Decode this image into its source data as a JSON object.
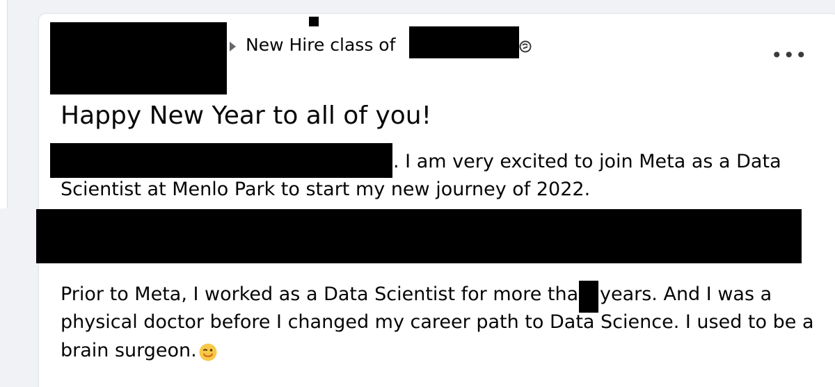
{
  "post": {
    "group_label": "New Hire class of",
    "title": "Happy New Year to all of you!",
    "intro_line1": ". I am very excited to join Meta as a Data",
    "intro_line2": "Scientist at Menlo Park to start my new journey of 2022.",
    "prior_line1_a": "Prior to Meta, I worked as a Data Scientist for more than",
    "prior_line1_b": "years. And I was a",
    "prior_line2": "physical doctor before I changed my career path to Data Science. I used to be a",
    "prior_line3": "brain surgeon.",
    "more_label": "•••",
    "more_icon": "more-options-icon",
    "audience_icon": "globe-icon",
    "emoji_icon": "winking-face-emoji"
  },
  "colors": {
    "background": "#f0f2f5",
    "card": "#ffffff",
    "text": "#050505",
    "secondary": "#65676b",
    "redaction": "#000000",
    "emoji": "#f7c948"
  }
}
